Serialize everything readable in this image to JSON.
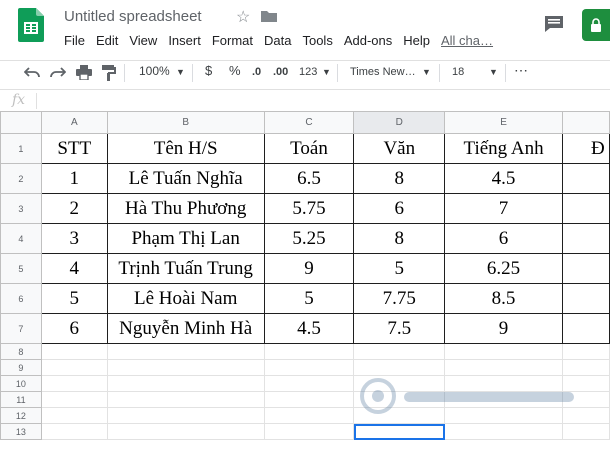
{
  "app": {
    "title": "Untitled spreadsheet",
    "last_edit": "All cha…",
    "menu": [
      "File",
      "Edit",
      "View",
      "Insert",
      "Format",
      "Data",
      "Tools",
      "Add-ons",
      "Help"
    ]
  },
  "toolbar": {
    "zoom": "100%",
    "currency": "$",
    "percent": "%",
    "dec_decrease": ".0",
    "dec_increase": ".00",
    "format_more": "123",
    "font": "Times New…",
    "font_size": "18",
    "more": "⋯"
  },
  "formula_bar": {
    "label": "fx",
    "value": ""
  },
  "columns": [
    "A",
    "B",
    "C",
    "D",
    "E"
  ],
  "rows_numbers": [
    "1",
    "2",
    "3",
    "4",
    "5",
    "6",
    "7",
    "8",
    "9",
    "10",
    "11",
    "12",
    "13"
  ],
  "table": {
    "header": [
      "STT",
      "Tên H/S",
      "Toán",
      "Văn",
      "Tiếng Anh",
      "Đ"
    ],
    "rows": [
      [
        "1",
        "Lê Tuấn Nghĩa",
        "6.5",
        "8",
        "4.5",
        ""
      ],
      [
        "2",
        "Hà Thu Phương",
        "5.75",
        "6",
        "7",
        ""
      ],
      [
        "3",
        "Phạm Thị Lan",
        "5.25",
        "8",
        "6",
        ""
      ],
      [
        "4",
        "Trịnh Tuấn Trung",
        "9",
        "5",
        "6.25",
        ""
      ],
      [
        "5",
        "Lê Hoài Nam",
        "5",
        "7.75",
        "8.5",
        ""
      ],
      [
        "6",
        "Nguyễn Minh Hà",
        "4.5",
        "7.5",
        "9",
        ""
      ]
    ]
  },
  "colors": {
    "accent": "#1a73e8",
    "share": "#1e8e3e",
    "logo": "#0f9d58"
  }
}
